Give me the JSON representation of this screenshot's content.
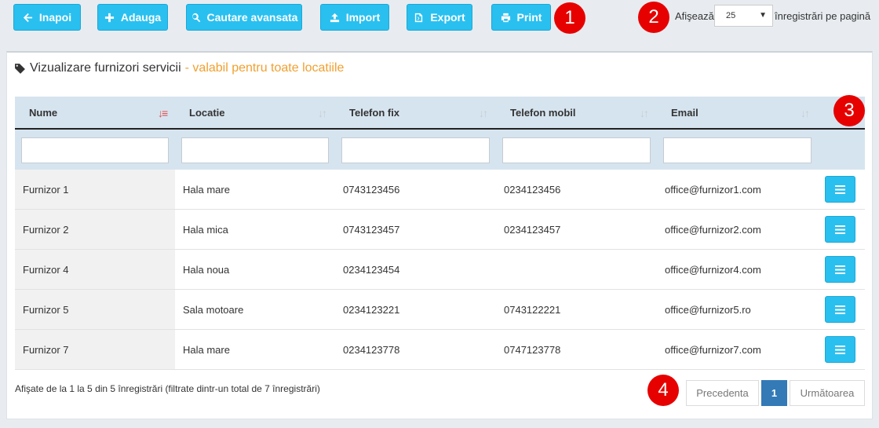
{
  "toolbar": {
    "back_label": "Inapoi",
    "add_label": "Adauga",
    "search_label": "Cautare avansata",
    "import_label": "Import",
    "export_label": "Export",
    "print_label": "Print"
  },
  "page_size": {
    "label_before": "Afişează",
    "selected": "25",
    "label_after": "înregistrări pe pagină"
  },
  "panel": {
    "title": "Vizualizare furnizori servicii",
    "subtitle": "- valabil pentru toate locatiile"
  },
  "table": {
    "columns": [
      "Nume",
      "Locatie",
      "Telefon fix",
      "Telefon mobil",
      "Email"
    ],
    "rows": [
      {
        "nume": "Furnizor 1",
        "locatie": "Hala mare",
        "telefon_fix": "0743123456",
        "telefon_mobil": "0234123456",
        "email": "office@furnizor1.com"
      },
      {
        "nume": "Furnizor 2",
        "locatie": "Hala mica",
        "telefon_fix": "0743123457",
        "telefon_mobil": "0234123457",
        "email": "office@furnizor2.com"
      },
      {
        "nume": "Furnizor 4",
        "locatie": "Hala noua",
        "telefon_fix": "0234123454",
        "telefon_mobil": "",
        "email": "office@furnizor4.com"
      },
      {
        "nume": "Furnizor 5",
        "locatie": "Sala motoare",
        "telefon_fix": "0234123221",
        "telefon_mobil": "0743122221",
        "email": "office@furnizor5.ro"
      },
      {
        "nume": "Furnizor 7",
        "locatie": "Hala mare",
        "telefon_fix": "0234123778",
        "telefon_mobil": "0747123778",
        "email": "office@furnizor7.com"
      }
    ]
  },
  "footer": {
    "info": "Afişate de la 1 la 5 din 5 înregistrări (filtrate dintr-un total de 7 înregistrări)",
    "prev_label": "Precedenta",
    "current_page": "1",
    "next_label": "Următoarea"
  },
  "annotations": [
    "1",
    "2",
    "3",
    "4"
  ],
  "colors": {
    "accent": "#29c0f0",
    "badge": "#e60000",
    "header_bg": "#d6e4ef",
    "subtitle": "#f0a030",
    "page_active": "#337ab7"
  },
  "icons": {
    "back": "arrow-left-icon",
    "add": "plus-icon",
    "search": "search-icon",
    "import": "upload-icon",
    "export": "file-export-icon",
    "print": "print-icon",
    "title": "tag-icon",
    "row_action": "menu-icon"
  }
}
